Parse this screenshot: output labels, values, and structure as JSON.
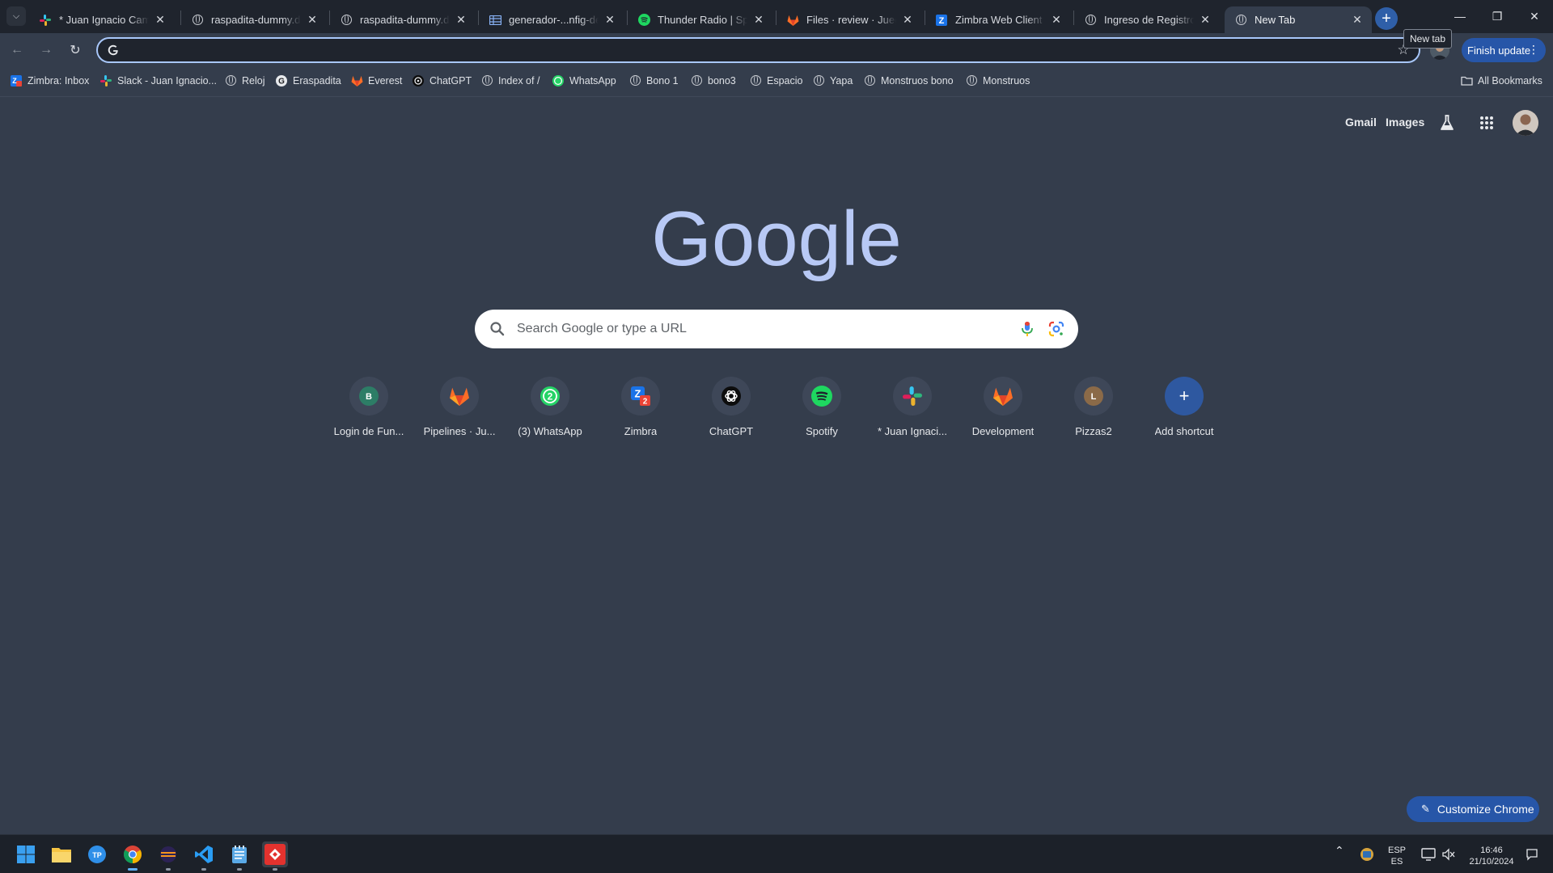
{
  "browser": {
    "tabs": [
      {
        "title": "* Juan Ignacio Cama",
        "icon": "slack-icon",
        "active": false
      },
      {
        "title": "raspadita-dummy.dev",
        "icon": "globe-icon",
        "active": false
      },
      {
        "title": "raspadita-dummy.dev",
        "icon": "globe-icon",
        "active": false
      },
      {
        "title": "generador-...nfig-des",
        "icon": "sheet-icon",
        "active": false
      },
      {
        "title": "Thunder Radio | Spoti",
        "icon": "spotify-icon",
        "active": false
      },
      {
        "title": "Files · review · Juegos",
        "icon": "gitlab-icon",
        "active": false
      },
      {
        "title": "Zimbra Web Client Si",
        "icon": "zimbra-icon",
        "active": false
      },
      {
        "title": "Ingreso de Registros",
        "icon": "globe-icon",
        "active": false
      },
      {
        "title": "New Tab",
        "icon": "chrome-icon",
        "active": true
      }
    ],
    "new_tab_tooltip": "New tab",
    "omnibox_value": "",
    "finish_update_label": "Finish update",
    "bookmarks": [
      {
        "label": "Zimbra: Inbox",
        "icon": "zimbra-icon"
      },
      {
        "label": "Slack - Juan Ignacio...",
        "icon": "slack-icon"
      },
      {
        "label": "Reloj",
        "icon": "globe-icon"
      },
      {
        "label": "Eraspadita",
        "icon": "google-icon"
      },
      {
        "label": "Everest",
        "icon": "gitlab-icon"
      },
      {
        "label": "ChatGPT",
        "icon": "chatgpt-icon"
      },
      {
        "label": "Index of /",
        "icon": "globe-icon"
      },
      {
        "label": "WhatsApp",
        "icon": "whatsapp-icon"
      },
      {
        "label": "Bono 1",
        "icon": "globe-icon"
      },
      {
        "label": "bono3",
        "icon": "globe-icon"
      },
      {
        "label": "Espacio",
        "icon": "globe-icon"
      },
      {
        "label": "Yapa",
        "icon": "globe-icon"
      },
      {
        "label": "Monstruos bono",
        "icon": "globe-icon"
      },
      {
        "label": "Monstruos",
        "icon": "globe-icon"
      }
    ],
    "all_bookmarks_label": "All Bookmarks"
  },
  "ntp": {
    "gmail_label": "Gmail",
    "images_label": "Images",
    "logo_text": "Google",
    "search_placeholder": "Search Google or type a URL",
    "shortcuts": [
      {
        "label": "Login de Fun...",
        "icon": "letter-b-icon",
        "letter": "B"
      },
      {
        "label": "Pipelines · Ju...",
        "icon": "gitlab-icon"
      },
      {
        "label": "(3) WhatsApp",
        "icon": "whatsapp-icon"
      },
      {
        "label": "Zimbra",
        "icon": "zimbra-icon"
      },
      {
        "label": "ChatGPT",
        "icon": "chatgpt-icon"
      },
      {
        "label": "Spotify",
        "icon": "spotify-icon"
      },
      {
        "label": "* Juan Ignaci...",
        "icon": "slack-icon"
      },
      {
        "label": "Development",
        "icon": "gitlab-icon"
      },
      {
        "label": "Pizzas2",
        "icon": "letter-l-icon",
        "letter": "L"
      },
      {
        "label": "Add shortcut",
        "icon": "plus-icon"
      }
    ],
    "customize_label": "Customize Chrome"
  },
  "taskbar": {
    "lang_top": "ESP",
    "lang_bottom": "ES",
    "time": "16:46",
    "date": "21/10/2024"
  },
  "colors": {
    "background": "#343d4c",
    "tabstrip": "#1f242d",
    "accent": "#2756a8",
    "omnibox_focus": "#a8c7fa"
  }
}
